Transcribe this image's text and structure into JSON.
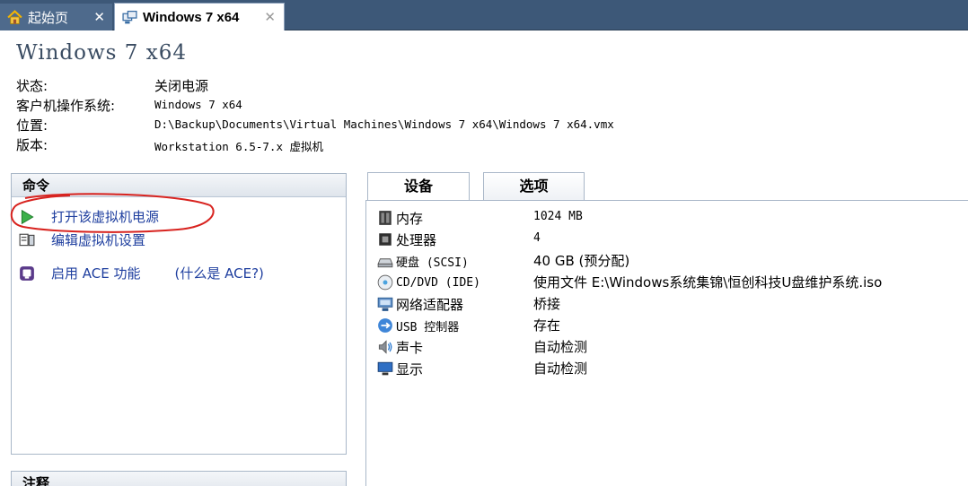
{
  "tabs": {
    "home_label": "起始页",
    "home_close": "✕",
    "vm_label": "Windows 7 x64",
    "vm_close": "✕"
  },
  "vm": {
    "title": "Windows 7 x64",
    "info": [
      {
        "key": "状态:",
        "value": "关闭电源"
      },
      {
        "key": "客户机操作系统:",
        "value": "Windows 7 x64"
      },
      {
        "key": "位置:",
        "value": "D:\\Backup\\Documents\\Virtual Machines\\Windows 7 x64\\Windows 7 x64.vmx"
      },
      {
        "key": "版本:",
        "value": "Workstation 6.5-7.x 虚拟机"
      }
    ]
  },
  "commands": {
    "header": "命令",
    "power_on": "打开该虚拟机电源",
    "edit_settings": "编辑虚拟机设置",
    "enable_ace": "启用 ACE 功能",
    "ace_help": "(什么是 ACE?)"
  },
  "notes": {
    "header": "注释"
  },
  "device_tabs": {
    "devices": "设备",
    "options": "选项"
  },
  "devices": [
    {
      "name": "内存",
      "value": "1024 MB"
    },
    {
      "name": "处理器",
      "value": "4"
    },
    {
      "name": "硬盘 (SCSI)",
      "value": "40 GB (预分配)"
    },
    {
      "name": "CD/DVD (IDE)",
      "value": "使用文件 E:\\Windows系统集锦\\恒创科技U盘维护系统.iso"
    },
    {
      "name": "网络适配器",
      "value": "桥接"
    },
    {
      "name": "USB 控制器",
      "value": "存在"
    },
    {
      "name": "声卡",
      "value": "自动检测"
    },
    {
      "name": "显示",
      "value": "自动检测"
    }
  ],
  "colors": {
    "tabbar": "#3d5878",
    "link": "#1f3f9f",
    "title": "#3a4c62",
    "highlight": "#d8231f",
    "panel_border": "#a9b7c8"
  },
  "icons": {
    "home_tab": "home-icon",
    "vm_tab": "vm-icon",
    "power_on": "play-icon",
    "edit_settings": "settings-icon",
    "enable_ace": "ace-icon",
    "devices": [
      "memory-icon",
      "cpu-icon",
      "hard-disk-icon",
      "cd-dvd-icon",
      "network-adapter-icon",
      "usb-icon",
      "sound-card-icon",
      "display-icon"
    ]
  }
}
